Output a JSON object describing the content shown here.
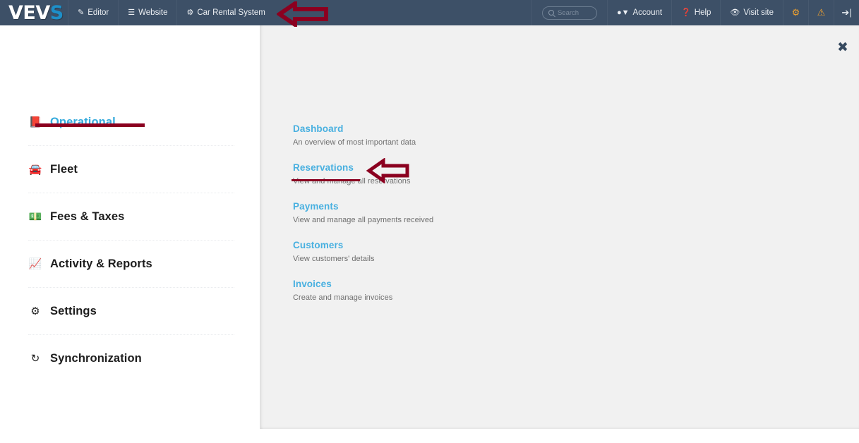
{
  "header": {
    "logo": {
      "primary": "VEV",
      "accent": "S"
    },
    "nav_left": [
      {
        "label": "Editor",
        "icon": "pencil-icon",
        "glyph": "✎"
      },
      {
        "label": "Website",
        "icon": "list-icon",
        "glyph": "☰"
      },
      {
        "label": "Car Rental System",
        "icon": "gear-icon",
        "glyph": "⚙"
      }
    ],
    "search": {
      "placeholder": "Search",
      "value": ""
    },
    "nav_right": [
      {
        "label": "Account",
        "icon": "user-icon",
        "glyph": "👤"
      },
      {
        "label": "Help",
        "icon": "help-icon",
        "glyph": "❓"
      },
      {
        "label": "Visit site",
        "icon": "eye-icon",
        "glyph": "👁"
      }
    ],
    "icon_buttons": [
      {
        "name": "settings-gear-icon",
        "glyph": "⚙",
        "color": "#f0a12e"
      },
      {
        "name": "warning-alert-icon",
        "glyph": "⚠",
        "color": "#f0a12e"
      },
      {
        "name": "logout-icon",
        "glyph": "→",
        "color": "#e4e9ee"
      }
    ]
  },
  "sidebar": {
    "items": [
      {
        "label": "Operational",
        "icon": "book-icon",
        "glyph": "📓",
        "active": true
      },
      {
        "label": "Fleet",
        "icon": "car-icon",
        "glyph": "🚗",
        "active": false
      },
      {
        "label": "Fees & Taxes",
        "icon": "money-icon",
        "glyph": "💵",
        "active": false
      },
      {
        "label": "Activity & Reports",
        "icon": "chart-icon",
        "glyph": "📈",
        "active": false
      },
      {
        "label": "Settings",
        "icon": "gear-icon",
        "glyph": "⚙",
        "active": false
      },
      {
        "label": "Synchronization",
        "icon": "refresh-icon",
        "glyph": "↻",
        "active": false
      }
    ]
  },
  "panel": {
    "close_label": "✖",
    "links": [
      {
        "title": "Dashboard",
        "desc": "An overview of most important data"
      },
      {
        "title": "Reservations",
        "desc": "View and manage all reservations"
      },
      {
        "title": "Payments",
        "desc": "View and manage all payments received"
      },
      {
        "title": "Customers",
        "desc": "View customers' details"
      },
      {
        "title": "Invoices",
        "desc": "Create and manage invoices"
      }
    ]
  },
  "annotations": {
    "color": "#8b0020",
    "underlines": [
      {
        "target": "Operational"
      },
      {
        "target": "Reservations"
      }
    ],
    "arrows": [
      {
        "target": "Car Rental System",
        "direction": "left"
      },
      {
        "target": "Reservations",
        "direction": "left"
      }
    ]
  },
  "colors": {
    "header_bg": "#3d5067",
    "panel_bg": "#f1f1f1",
    "link_blue": "#48b0e0",
    "accent_blue": "#34aadc",
    "annotation_red": "#8b0020",
    "icon_orange": "#f0a12e"
  }
}
